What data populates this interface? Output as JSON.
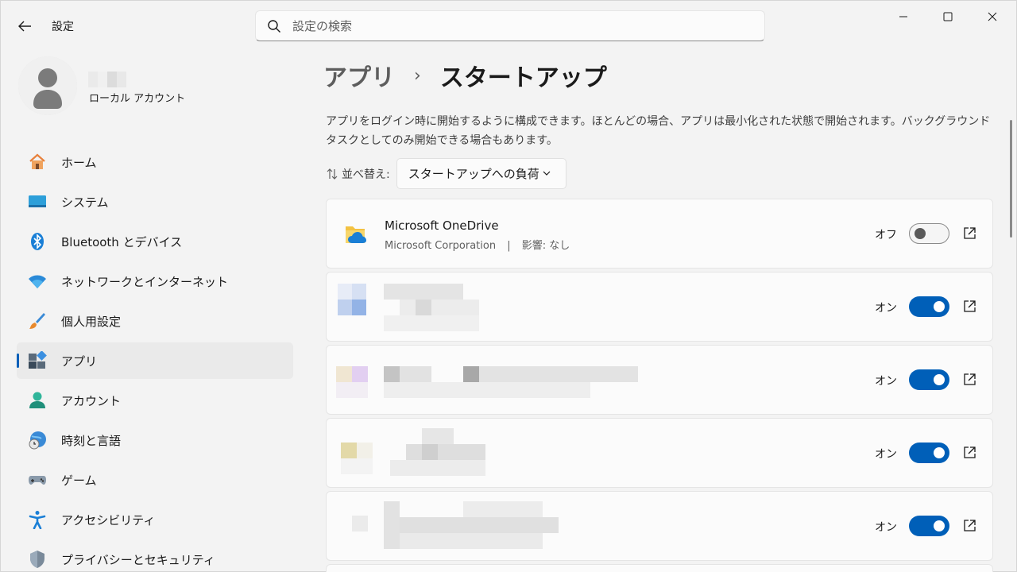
{
  "window": {
    "title": "設定",
    "controls": {
      "minimize": "minimize",
      "maximize": "maximize",
      "close": "close"
    }
  },
  "search": {
    "placeholder": "設定の検索"
  },
  "profile": {
    "account_type": "ローカル アカウント"
  },
  "sidebar": {
    "items": [
      {
        "label": "ホーム",
        "icon": "home-icon"
      },
      {
        "label": "システム",
        "icon": "system-icon"
      },
      {
        "label": "Bluetooth とデバイス",
        "icon": "bluetooth-icon"
      },
      {
        "label": "ネットワークとインターネット",
        "icon": "wifi-icon"
      },
      {
        "label": "個人用設定",
        "icon": "brush-icon"
      },
      {
        "label": "アプリ",
        "icon": "apps-icon",
        "active": true
      },
      {
        "label": "アカウント",
        "icon": "account-icon"
      },
      {
        "label": "時刻と言語",
        "icon": "globe-clock-icon"
      },
      {
        "label": "ゲーム",
        "icon": "gamepad-icon"
      },
      {
        "label": "アクセシビリティ",
        "icon": "accessibility-icon"
      },
      {
        "label": "プライバシーとセキュリティ",
        "icon": "shield-icon"
      }
    ]
  },
  "main": {
    "breadcrumb": {
      "parent": "アプリ",
      "separator": "›",
      "current": "スタートアップ"
    },
    "description": "アプリをログイン時に開始するように構成できます。ほとんどの場合、アプリは最小化された状態で開始されます。バックグラウンド タスクとしてのみ開始できる場合もあります。",
    "sort": {
      "label": "並べ替え:",
      "value": "スタートアップへの負荷"
    },
    "apps": [
      {
        "name": "Microsoft OneDrive",
        "publisher": "Microsoft Corporation",
        "separator": "|",
        "impact": "影響: なし",
        "state_label": "オフ",
        "enabled": false
      },
      {
        "name": "",
        "publisher": "",
        "state_label": "オン",
        "enabled": true
      },
      {
        "name": "",
        "publisher": "",
        "state_label": "オン",
        "enabled": true
      },
      {
        "name": "",
        "publisher": "",
        "state_label": "オン",
        "enabled": true
      },
      {
        "name": "",
        "publisher": "",
        "state_label": "オン",
        "enabled": true
      }
    ]
  },
  "colors": {
    "accent": "#005fb8",
    "background": "#f3f3f3",
    "card": "#fbfbfb"
  }
}
